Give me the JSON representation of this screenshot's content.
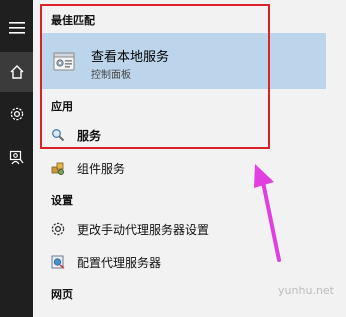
{
  "sidebar": {
    "items": [
      {
        "icon": "hamburger-menu-icon"
      },
      {
        "icon": "home-icon",
        "active": true
      },
      {
        "icon": "gear-icon"
      },
      {
        "icon": "feedback-person-icon"
      }
    ]
  },
  "results": {
    "best_match_header": "最佳匹配",
    "best_match": {
      "title": "查看本地服务",
      "subtitle": "控制面板",
      "icon": "services-icon"
    },
    "apps_header": "应用",
    "apps": [
      {
        "label": "服务",
        "icon": "magnifier-services-icon"
      }
    ],
    "component_services": {
      "label": "组件服务",
      "icon": "component-services-icon"
    },
    "settings_header": "设置",
    "settings": [
      {
        "label": "更改手动代理服务器设置",
        "icon": "gear-icon"
      },
      {
        "label": "配置代理服务器",
        "icon": "proxy-config-icon"
      }
    ],
    "web_header": "网页"
  },
  "annotation": {
    "highlight_color": "#d8232a",
    "arrow_color": "#e040e0"
  },
  "watermark": "yunhu.net"
}
